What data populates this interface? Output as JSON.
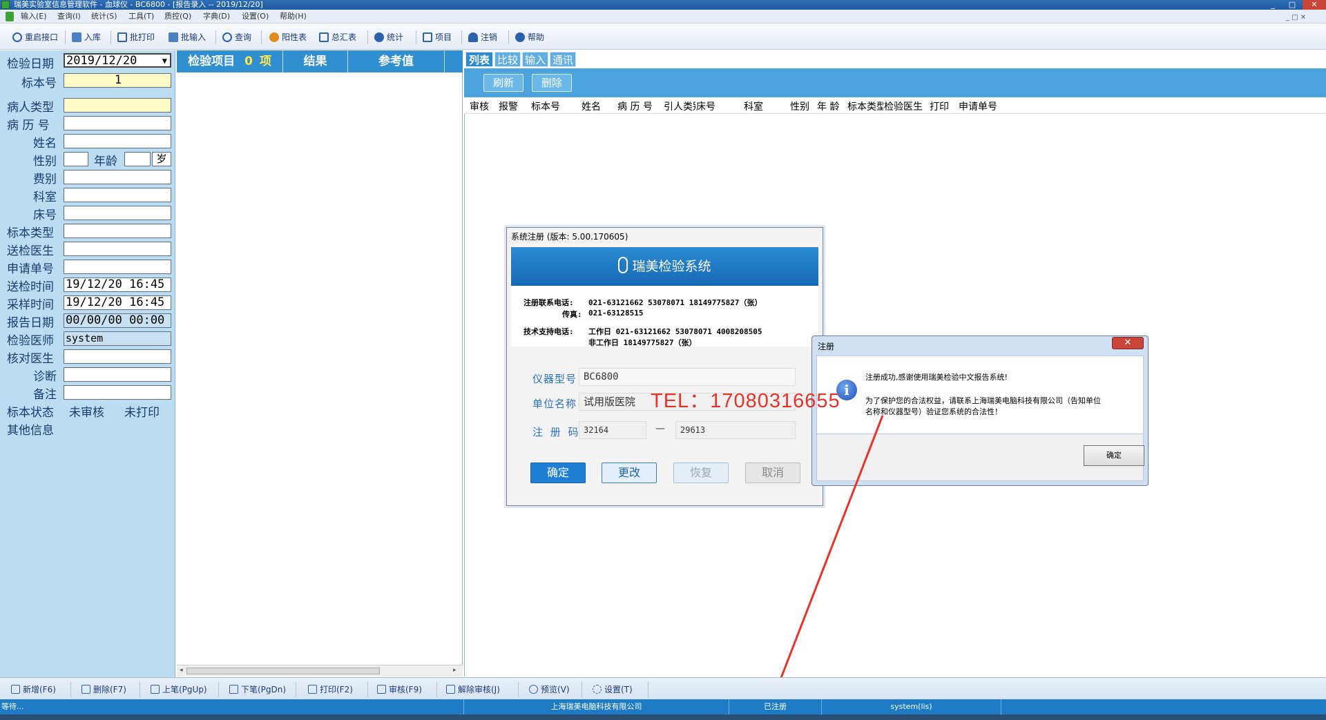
{
  "window": {
    "title": "瑞美实验室信息管理软件 - 血球仪 - BC6800 - [报告录入 -- 2019/12/20]",
    "min": "_",
    "max": "□",
    "close": "✕"
  },
  "menu": [
    "输入(E)",
    "查询(I)",
    "统计(S)",
    "工具(T)",
    "质控(Q)",
    "字典(D)",
    "设置(O)",
    "帮助(H)"
  ],
  "toolbar": [
    "重启接口",
    "入库",
    "批打印",
    "批输入",
    "查询",
    "阳性表",
    "总汇表",
    "统计",
    "项目",
    "注销",
    "帮助"
  ],
  "form": {
    "date_label": "检验日期",
    "date_value": "2019/12/20",
    "sample_no_label": "标本号",
    "sample_no_value": "1",
    "patient_type_label": "病人类型",
    "record_no_label": "病 历 号",
    "name_label": "姓名",
    "gender_label": "性别",
    "age_label": "年龄",
    "age_unit": "岁",
    "fee_label": "费别",
    "dept_label": "科室",
    "bed_label": "床号",
    "sample_type_label": "标本类型",
    "send_doctor_label": "送检医生",
    "request_no_label": "申请单号",
    "send_time_label": "送检时间",
    "send_time_value": "19/12/20 16:45",
    "collect_time_label": "采样时间",
    "collect_time_value": "19/12/20 16:45",
    "report_date_label": "报告日期",
    "report_date_value": "00/00/00 00:00",
    "test_doctor_label": "检验医师",
    "test_doctor_value": "system",
    "check_doctor_label": "核对医生",
    "diagnosis_label": "诊断",
    "remark_label": "备注",
    "status_label": "标本状态",
    "status_audit": "未审核",
    "status_print": "未打印",
    "other_label": "其他信息"
  },
  "middle": {
    "items_label": "检验项目",
    "items_count": "0",
    "items_unit": "项",
    "result_label": "结果",
    "reference_label": "参考值"
  },
  "right": {
    "tabs": [
      "列表",
      "比较",
      "输入",
      "通讯"
    ],
    "refresh": "刷新",
    "delete": "删除",
    "columns": [
      "审核",
      "报警",
      "标本号",
      "姓名",
      "病 历 号",
      "引人类别",
      "床号",
      "科室",
      "性别",
      "年 龄",
      "标本类型",
      "检验医生",
      "打印",
      "申请单号"
    ]
  },
  "bottom": [
    "新增(F6)",
    "删除(F7)",
    "上笔(PgUp)",
    "下笔(PgDn)",
    "打印(F2)",
    "审核(F9)",
    "解除审核(J)",
    "预览(V)",
    "设置(T)"
  ],
  "status": {
    "left": "等待...",
    "company": "上海瑞美电脑科技有限公司",
    "registered": "已注册",
    "user": "system(lis)"
  },
  "register_dialog": {
    "title": "系统注册 (版本: 5.00.170605)",
    "banner": "瑞美检验系统",
    "reg_phone_label": "注册联系电话:",
    "reg_phone": "021-63121662 53078071 18149775827（张）",
    "fax_label": "传真:",
    "fax": "021-63128515",
    "tech_label": "技术支持电话:",
    "tech_work": "工作日 021-63121662 53078071 4008208505",
    "tech_offwork": "非工作日 18149775827（张）",
    "model_label": "仪器型号",
    "model_value": "BC6800",
    "unit_label": "单位名称",
    "unit_value": "试用版医院",
    "code_label": "注 册 码",
    "code_part1": "32164",
    "code_dash": "—",
    "code_part2": "29613",
    "btn_ok": "确定",
    "btn_change": "更改",
    "btn_restore": "恢复",
    "btn_cancel": "取消"
  },
  "message_dialog": {
    "title": "注册",
    "close": "✕",
    "line1": "注册成功,感谢使用瑞美检验中文报告系统!",
    "line2": "为了保护您的合法权益，请联系上海瑞美电脑科技有限公司（告知单位",
    "line3": "名称和仪器型号）验证您系统的合法性！",
    "ok": "确定"
  },
  "overlay_tel": "TEL：17080316655",
  "colors": {
    "accent": "#2d8ad0",
    "arrow": "#e8332b",
    "form_bg": "#bcdcf1",
    "highlight": "#fffbc4"
  }
}
